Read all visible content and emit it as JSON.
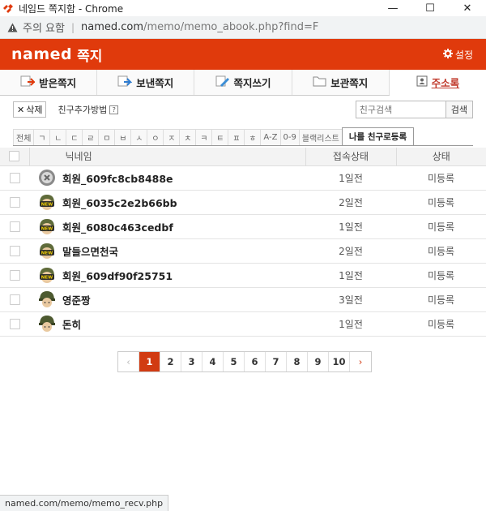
{
  "window": {
    "title": "네임드 쪽지함 - Chrome",
    "minimize": "—",
    "maximize": "☐",
    "close": "✕"
  },
  "urlbar": {
    "warning": "주의 요함",
    "url_host": "named.com",
    "url_path": "/memo/memo_abook.php?find=F"
  },
  "header": {
    "logo": "named",
    "subtitle": "쪽지",
    "settings": "설정"
  },
  "tabs": [
    {
      "label": "받은쪽지"
    },
    {
      "label": "보낸쪽지"
    },
    {
      "label": "쪽지쓰기"
    },
    {
      "label": "보관쪽지"
    },
    {
      "label": "주소록"
    }
  ],
  "toolbar": {
    "delete_label": "삭제",
    "howto_label": "친구추가방법",
    "help": "?",
    "search_placeholder": "친구검색",
    "search_button": "검색"
  },
  "filter": [
    "전체",
    "ㄱ",
    "ㄴ",
    "ㄷ",
    "ㄹ",
    "ㅁ",
    "ㅂ",
    "ㅅ",
    "ㅇ",
    "ㅈ",
    "ㅊ",
    "ㅋ",
    "ㅌ",
    "ㅍ",
    "ㅎ",
    "A-Z",
    "0-9",
    "블랙리스트",
    "나를 친구로등록"
  ],
  "table": {
    "headers": {
      "nick": "닉네임",
      "last": "접속상태",
      "status": "상태"
    },
    "rows": [
      {
        "name": "회원_609fc8cb8488e",
        "last": "1일전",
        "status": "미등록",
        "avatar": "x"
      },
      {
        "name": "회원_6035c2e2b66bb",
        "last": "2일전",
        "status": "미등록",
        "avatar": "new"
      },
      {
        "name": "회원_6080c463cedbf",
        "last": "1일전",
        "status": "미등록",
        "avatar": "new"
      },
      {
        "name": "말들으면천국",
        "last": "2일전",
        "status": "미등록",
        "avatar": "new"
      },
      {
        "name": "회원_609df90f25751",
        "last": "1일전",
        "status": "미등록",
        "avatar": "new"
      },
      {
        "name": "영준짱",
        "last": "3일전",
        "status": "미등록",
        "avatar": "soldier"
      },
      {
        "name": "돈히",
        "last": "1일전",
        "status": "미등록",
        "avatar": "soldier"
      }
    ]
  },
  "pagination": {
    "prev": "‹",
    "pages": [
      "1",
      "2",
      "3",
      "4",
      "5",
      "6",
      "7",
      "8",
      "9",
      "10"
    ],
    "next": "›"
  },
  "statusbar": "named.com/memo/memo_recv.php",
  "colors": {
    "brand": "#e03a0c",
    "active_page": "#d13b12"
  }
}
